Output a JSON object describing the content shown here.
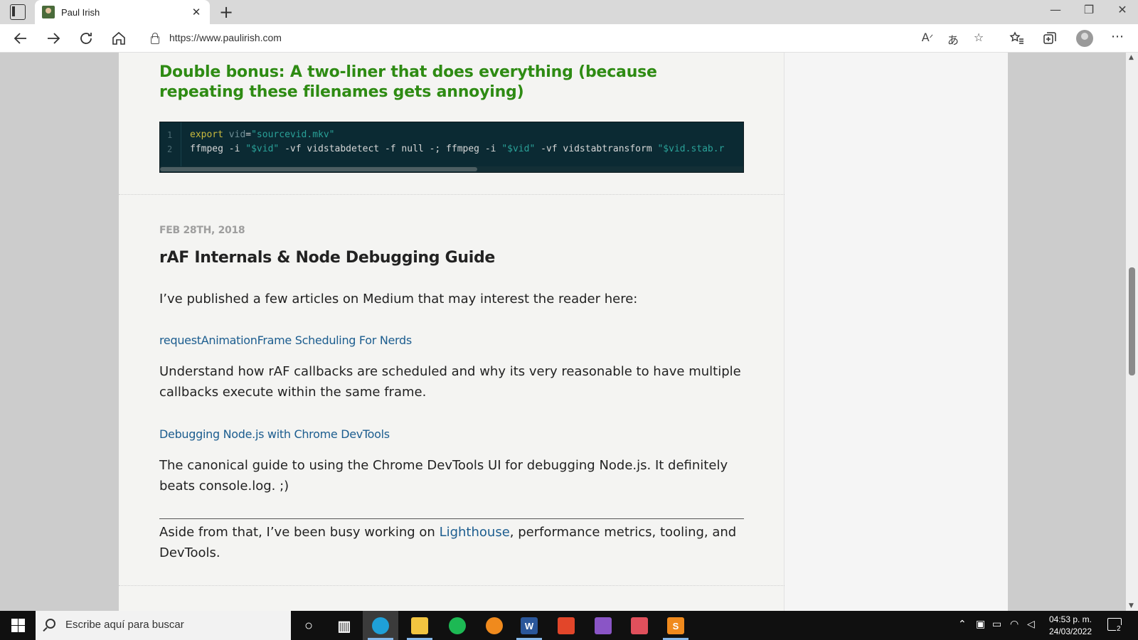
{
  "browser": {
    "tab_title": "Paul Irish",
    "tab_close": "✕",
    "new_tab": "+",
    "url": "https://www.paulirish.com",
    "window_controls": {
      "minimize": "—",
      "restore": "❐",
      "close": "✕"
    },
    "icons": {
      "back": "back-icon",
      "forward": "forward-icon",
      "refresh": "refresh-icon",
      "home": "home-icon",
      "read_aloud": "read-aloud-icon",
      "translate": "translate-icon",
      "add_favorite": "star-add-icon",
      "favorites": "favorites-icon",
      "collections": "collections-icon",
      "profile": "avatar-icon",
      "more": "more-icon"
    }
  },
  "article": {
    "bonus_heading": "Double bonus: A two-liner that does everything (because repeating these filenames gets annoying)",
    "code": {
      "line_numbers": [
        "1",
        "2"
      ],
      "line1": {
        "kw": "export",
        "var": "vid",
        "eq": "=",
        "str": "\"sourcevid.mkv\""
      },
      "line2": {
        "p1": "ffmpeg -i ",
        "s1": "\"$vid\"",
        "p2": " -vf vidstabdetect -f null -; ffmpeg -i ",
        "s2": "\"$vid\"",
        "p3": " -vf vidstabtransform ",
        "s3": "\"$vid.stab.r"
      }
    },
    "post_date": "FEB 28TH, 2018",
    "post_title": "rAF Internals & Node Debugging Guide",
    "intro": "I’ve published a few articles on Medium that may interest the reader here:",
    "link1": "requestAnimationFrame Scheduling For Nerds",
    "link1_desc": "Understand how rAF callbacks are scheduled and why its very reasonable to have multiple callbacks execute within the same frame.",
    "link2": "Debugging Node.js with Chrome DevTools",
    "link2_desc": "The canonical guide to using the Chrome DevTools UI for debugging Node.js. It definitely beats console.log. ;)",
    "aside_pre": "Aside from that, I’ve been busy working on ",
    "aside_link": "Lighthouse",
    "aside_post": ", performance metrics, tooling, and DevTools."
  },
  "taskbar": {
    "search_placeholder": "Escribe aquí para buscar",
    "time": "04:53 p. m.",
    "date": "24/03/2022",
    "notifications": "2",
    "apps": [
      {
        "name": "cortana",
        "glyph": "○",
        "color": "#ffffff"
      },
      {
        "name": "task-view",
        "glyph": "▥",
        "color": "#ffffff"
      },
      {
        "name": "edge",
        "glyph": "",
        "color": "#1fa0d8"
      },
      {
        "name": "file-explorer",
        "glyph": "",
        "color": "#f2c440"
      },
      {
        "name": "spotify",
        "glyph": "",
        "color": "#1db954"
      },
      {
        "name": "brave",
        "glyph": "",
        "color": "#f08a1d"
      },
      {
        "name": "word",
        "glyph": "W",
        "color": "#2b579a"
      },
      {
        "name": "office",
        "glyph": "",
        "color": "#e2462a"
      },
      {
        "name": "visual-studio",
        "glyph": "",
        "color": "#8a55c6"
      },
      {
        "name": "acrobat",
        "glyph": "",
        "color": "#e0505c"
      },
      {
        "name": "sublime-text",
        "glyph": "S",
        "color": "#f08a1d"
      }
    ]
  }
}
